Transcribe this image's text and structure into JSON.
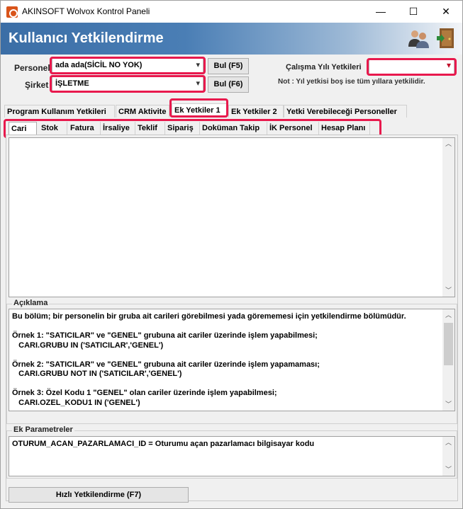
{
  "window": {
    "title": "AKINSOFT Wolvox Kontrol Paneli",
    "minimize": "—",
    "maximize": "☐",
    "close": "✕"
  },
  "header": {
    "title": "Kullanıcı Yetkilendirme",
    "icons": [
      "users-icon",
      "exit-door-icon"
    ]
  },
  "form": {
    "personel_label": "Personel",
    "personel_value": "ada ada(SİCİL NO YOK)",
    "sirket_label": "Şirket",
    "sirket_value": "İŞLETME",
    "bul_f5": "Bul (F5)",
    "bul_f6": "Bul (F6)",
    "calisma_label": "Çalışma Yılı Yetkileri",
    "calisma_value": "",
    "note": "Not : Yıl yetkisi boş ise tüm yıllara yetkilidir."
  },
  "main_tabs": [
    {
      "label": "Program Kullanım Yetkileri"
    },
    {
      "label": "CRM Aktivite"
    },
    {
      "label": "Ek Yetkiler 1"
    },
    {
      "label": "Ek Yetkiler 2"
    },
    {
      "label": "Yetki Verebileceği Personeller"
    }
  ],
  "active_main_tab": "Ek Yetkiler 1",
  "sub_tabs": [
    {
      "label": "Cari"
    },
    {
      "label": "Stok"
    },
    {
      "label": "Fatura"
    },
    {
      "label": "İrsaliye"
    },
    {
      "label": "Teklif"
    },
    {
      "label": "Sipariş"
    },
    {
      "label": "Doküman Takip"
    },
    {
      "label": "İK Personel"
    },
    {
      "label": "Hesap Planı"
    }
  ],
  "active_sub_tab": "Cari",
  "editor": {
    "value": ""
  },
  "aciklama": {
    "label": "Açıklama",
    "text": "Bu bölüm; bir personelin bir gruba ait carileri görebilmesi yada görememesi için yetkilendirme bölümüdür.\n\nÖrnek 1: \"SATICILAR\" ve \"GENEL\" grubuna ait cariler üzerinde işlem yapabilmesi;\n   CARI.GRUBU IN ('SATICILAR','GENEL')\n\nÖrnek 2: \"SATICILAR\" ve \"GENEL\" grubuna ait cariler üzerinde işlem yapamaması;\n   CARI.GRUBU NOT IN ('SATICILAR','GENEL')\n\nÖrnek 3: Özel Kodu 1 \"GENEL\" olan cariler üzerinde işlem yapabilmesi;\n   CARI.OZEL_KODU1 IN ('GENEL')"
  },
  "ek_parametreler": {
    "label": "Ek Parametreler",
    "text": "OTURUM_ACAN_PAZARLAMACI_ID = Oturumu açan pazarlamacı bilgisayar kodu"
  },
  "footer": {
    "hizli_button": "Hızlı Yetkilendirme (F7)"
  },
  "colors": {
    "highlight": "#e8194d",
    "header_blue": "#3b6ea6"
  }
}
